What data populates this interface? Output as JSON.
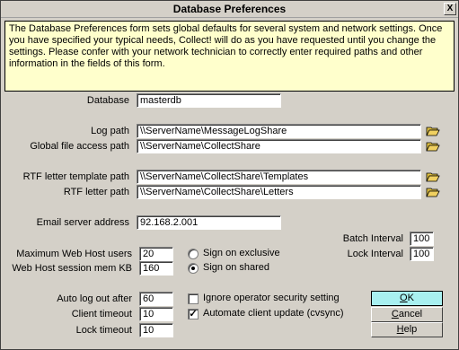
{
  "window": {
    "title": "Database Preferences",
    "close_glyph": "X"
  },
  "info_text": "The Database Preferences form sets global defaults for several system and network settings. Once you have specified your typical needs, Collect! will do as you have requested until you change the settings. Please confer with your network technician to correctly enter required paths and other information in the fields of this form.",
  "fields": {
    "database": {
      "label": "Database",
      "value": "masterdb"
    },
    "log_path": {
      "label": "Log path",
      "value": "\\\\ServerName\\MessageLogShare"
    },
    "global_file_access_path": {
      "label": "Global file access path",
      "value": "\\\\ServerName\\CollectShare"
    },
    "rtf_template_path": {
      "label": "RTF letter template path",
      "value": "\\\\ServerName\\CollectShare\\Templates"
    },
    "rtf_letter_path": {
      "label": "RTF letter path",
      "value": "\\\\ServerName\\CollectShare\\Letters"
    },
    "email_server": {
      "label": "Email server address",
      "value": "92.168.2.001"
    },
    "batch_interval": {
      "label": "Batch Interval",
      "value": "100"
    },
    "lock_interval": {
      "label": "Lock Interval",
      "value": "100"
    },
    "max_web_host_users": {
      "label": "Maximum Web Host users",
      "value": "20"
    },
    "web_host_session_mem": {
      "label": "Web Host session mem KB",
      "value": "160"
    },
    "auto_log_out": {
      "label": "Auto log out after",
      "value": "60"
    },
    "client_timeout": {
      "label": "Client timeout",
      "value": "10"
    },
    "lock_timeout": {
      "label": "Lock timeout",
      "value": "10"
    }
  },
  "radios": {
    "sign_on_exclusive": {
      "label": "Sign on exclusive",
      "selected": false
    },
    "sign_on_shared": {
      "label": "Sign on shared",
      "selected": true
    }
  },
  "checks": {
    "ignore_operator_security": {
      "label": "Ignore operator security setting",
      "checked": false,
      "mark": ""
    },
    "automate_client_update": {
      "label": "Automate client update (cvsync)",
      "checked": true,
      "mark": "✓"
    }
  },
  "buttons": {
    "ok": {
      "hotkey": "O",
      "rest": "K"
    },
    "cancel": {
      "hotkey": "C",
      "rest": "ancel"
    },
    "help": {
      "hotkey": "H",
      "rest": "elp"
    }
  },
  "icons": {
    "browse": "folder-open-icon",
    "folder_color": "#c8a000"
  }
}
